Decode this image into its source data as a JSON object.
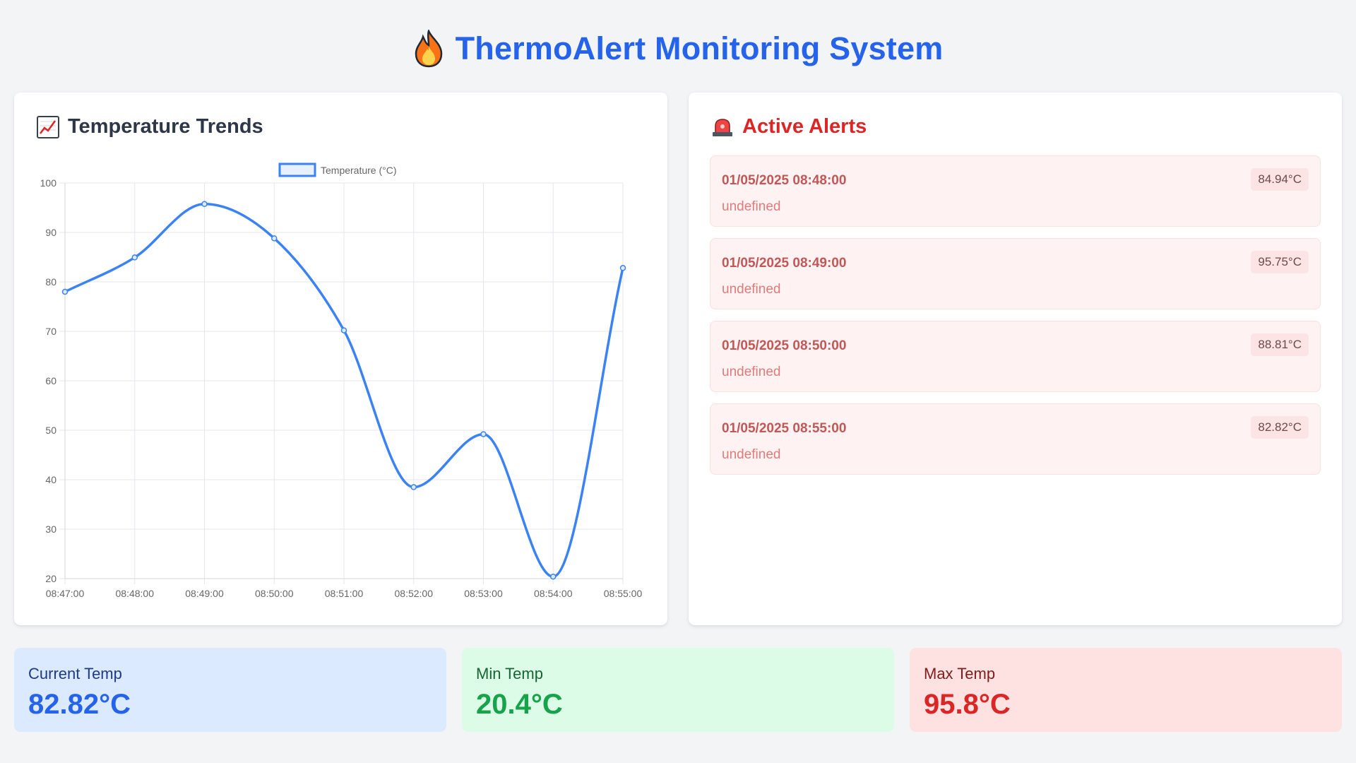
{
  "app": {
    "title": "ThermoAlert Monitoring System",
    "title_icon": "fire-icon"
  },
  "trends": {
    "title": "Temperature Trends",
    "icon": "chart-increasing-icon"
  },
  "alerts": {
    "title": "Active Alerts",
    "icon": "police-light-icon",
    "items": [
      {
        "time": "01/05/2025 08:48:00",
        "message": "undefined",
        "temp": "84.94°C"
      },
      {
        "time": "01/05/2025 08:49:00",
        "message": "undefined",
        "temp": "95.75°C"
      },
      {
        "time": "01/05/2025 08:50:00",
        "message": "undefined",
        "temp": "88.81°C"
      },
      {
        "time": "01/05/2025 08:55:00",
        "message": "undefined",
        "temp": "82.82°C"
      }
    ]
  },
  "stats": {
    "current": {
      "label": "Current Temp",
      "value": "82.82°C"
    },
    "min": {
      "label": "Min Temp",
      "value": "20.4°C"
    },
    "max": {
      "label": "Max Temp",
      "value": "95.8°C"
    }
  },
  "colors": {
    "accent": "#2563eb",
    "line": "#3b82f6",
    "alert": "#dc2626",
    "success": "#16a34a"
  },
  "chart_data": {
    "type": "line",
    "x": [
      "08:47:00",
      "08:48:00",
      "08:49:00",
      "08:50:00",
      "08:51:00",
      "08:52:00",
      "08:53:00",
      "08:54:00",
      "08:55:00"
    ],
    "series": [
      {
        "name": "Temperature (°C)",
        "values": [
          78.0,
          84.94,
          95.75,
          88.81,
          70.2,
          38.5,
          49.2,
          20.4,
          82.82
        ]
      }
    ],
    "ylim": [
      20,
      100
    ],
    "yticks": [
      20,
      30,
      40,
      50,
      60,
      70,
      80,
      90,
      100
    ],
    "grid": true,
    "legend": "top"
  }
}
